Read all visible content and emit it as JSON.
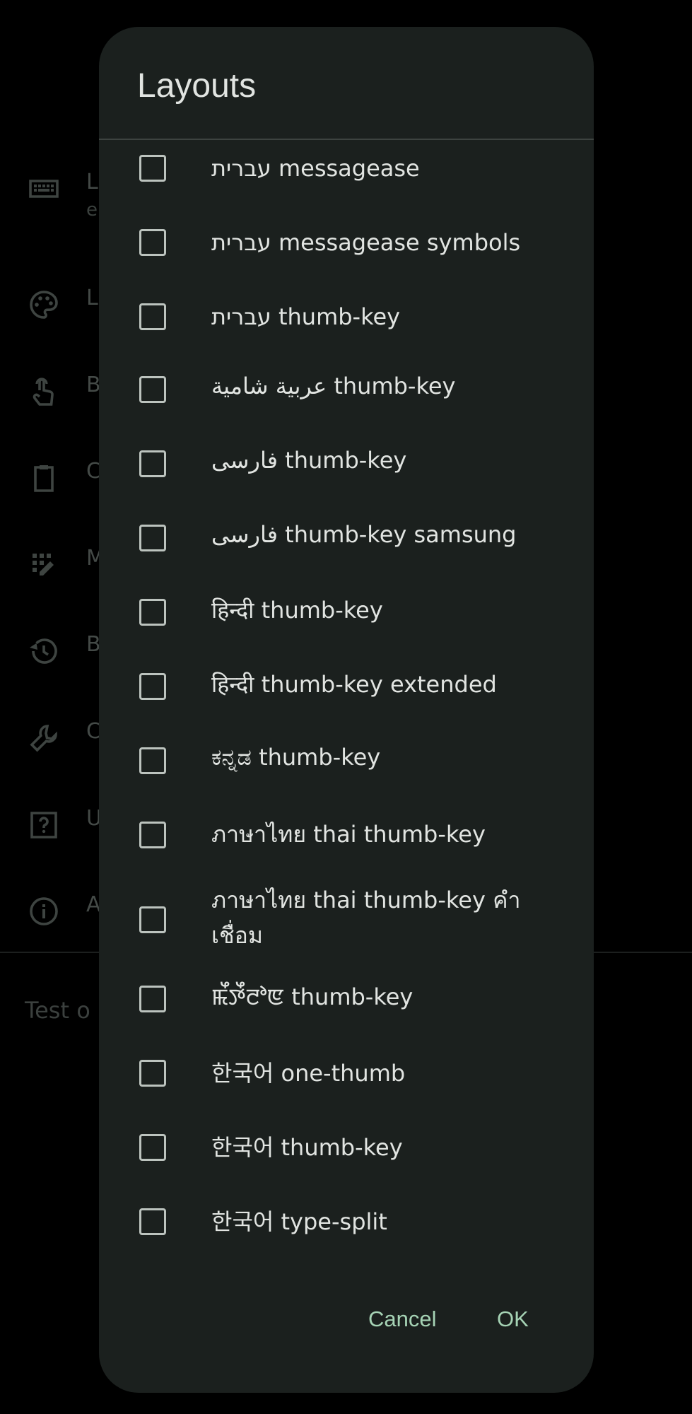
{
  "background": {
    "items": [
      {
        "icon": "keyboard-icon",
        "title": "L",
        "subtitle": "e"
      },
      {
        "icon": "palette-icon",
        "title": "L"
      },
      {
        "icon": "touch-icon",
        "title": "B"
      },
      {
        "icon": "clipboard-icon",
        "title": "C"
      },
      {
        "icon": "grid-edit-icon",
        "title": "M"
      },
      {
        "icon": "history-icon",
        "title": "B"
      },
      {
        "icon": "wrench-icon",
        "title": "C"
      },
      {
        "icon": "help-icon",
        "title": "U"
      },
      {
        "icon": "info-icon",
        "title": "A"
      }
    ],
    "test_text": "Test o"
  },
  "dialog": {
    "title": "Layouts",
    "options": [
      {
        "label": "עברית messagease",
        "checked": false
      },
      {
        "label": "עברית messagease symbols",
        "checked": false
      },
      {
        "label": "עברית thumb-key",
        "checked": false
      },
      {
        "label": "عربية شامية thumb-key",
        "checked": false
      },
      {
        "label": "فارسی thumb-key",
        "checked": false
      },
      {
        "label": "فارسی thumb-key samsung",
        "checked": false
      },
      {
        "label": "हिन्दी thumb-key",
        "checked": false
      },
      {
        "label": "हिन्दी thumb-key extended",
        "checked": false
      },
      {
        "label": "ಕನ್ನಡ thumb-key",
        "checked": false
      },
      {
        "label": "ภาษาไทย thai thumb-key",
        "checked": false
      },
      {
        "label": "ภาษาไทย thai thumb-key คำเชื่อม",
        "checked": false
      },
      {
        "label": "ꯃꯩꯇꯩꯂꯣꯟ thumb-key",
        "checked": false
      },
      {
        "label": "한국어 one-thumb",
        "checked": false
      },
      {
        "label": "한국어 thumb-key",
        "checked": false
      },
      {
        "label": "한국어 type-split",
        "checked": false
      }
    ],
    "cancel_label": "Cancel",
    "ok_label": "OK"
  }
}
